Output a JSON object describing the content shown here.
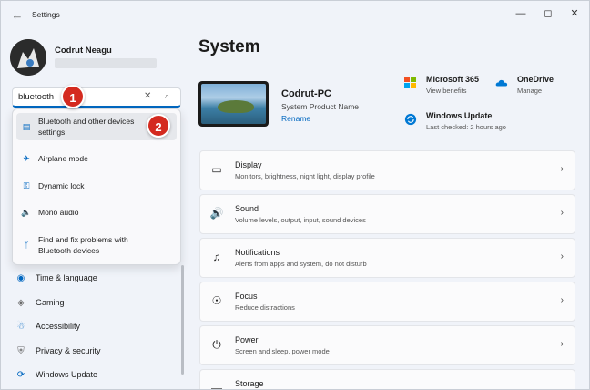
{
  "window": {
    "title": "Settings",
    "back_icon": "back-arrow-icon",
    "minimize_icon": "minimize-icon",
    "maximize_icon": "maximize-icon",
    "close_icon": "close-icon"
  },
  "user": {
    "name": "Codrut Neagu"
  },
  "search": {
    "value": "bluetooth",
    "clear_symbol": "✕",
    "search_symbol": "⌕"
  },
  "search_results": [
    {
      "label": "Bluetooth and other devices settings",
      "icon": "devices-icon"
    },
    {
      "label": "Airplane mode",
      "icon": "airplane-icon"
    },
    {
      "label": "Dynamic lock",
      "icon": "key-icon"
    },
    {
      "label": "Mono audio",
      "icon": "speaker-icon"
    },
    {
      "label": "Find and fix problems with Bluetooth devices",
      "icon": "bluetooth-icon"
    }
  ],
  "callouts": [
    "1",
    "2"
  ],
  "nav": [
    {
      "label": "Time & language",
      "icon": "globe-icon"
    },
    {
      "label": "Gaming",
      "icon": "gamepad-icon"
    },
    {
      "label": "Accessibility",
      "icon": "accessibility-icon"
    },
    {
      "label": "Privacy & security",
      "icon": "shield-icon"
    },
    {
      "label": "Windows Update",
      "icon": "update-icon"
    }
  ],
  "main": {
    "title": "System",
    "pc_name": "Codrut-PC",
    "pc_model": "System Product Name",
    "rename_label": "Rename"
  },
  "quick_links": [
    {
      "title": "Microsoft 365",
      "subtitle": "View benefits",
      "icon": "microsoft-365-icon"
    },
    {
      "title": "OneDrive",
      "subtitle": "Manage",
      "icon": "onedrive-icon"
    },
    {
      "title": "Windows Update",
      "subtitle": "Last checked: 2 hours ago",
      "icon": "windows-update-icon"
    }
  ],
  "cards": [
    {
      "title": "Display",
      "subtitle": "Monitors, brightness, night light, display profile",
      "icon": "display-icon"
    },
    {
      "title": "Sound",
      "subtitle": "Volume levels, output, input, sound devices",
      "icon": "sound-icon"
    },
    {
      "title": "Notifications",
      "subtitle": "Alerts from apps and system, do not disturb",
      "icon": "bell-icon"
    },
    {
      "title": "Focus",
      "subtitle": "Reduce distractions",
      "icon": "focus-icon"
    },
    {
      "title": "Power",
      "subtitle": "Screen and sleep, power mode",
      "icon": "power-icon"
    },
    {
      "title": "Storage",
      "subtitle": "",
      "icon": "storage-icon"
    }
  ],
  "colors": {
    "accent": "#0067c0",
    "callout": "#d42a1f",
    "background": "#f0f3f9"
  }
}
